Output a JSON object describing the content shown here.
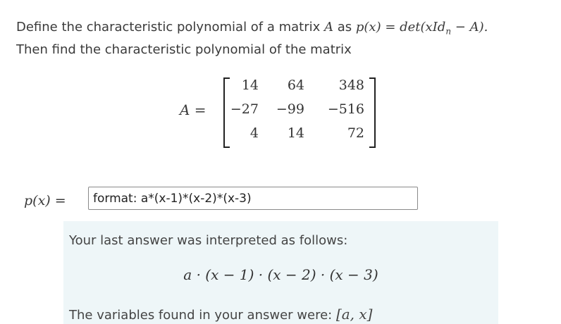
{
  "question": {
    "line1_text": "Define the characteristic polynomial of a matrix ",
    "line1_var": "A",
    "line1_as": " as ",
    "line1_formula": "p(x) = det(xId",
    "line1_sub": "n",
    "line1_formula_end": " − A).",
    "line2": "Then find the characteristic polynomial of the matrix"
  },
  "matrix": {
    "lhs": "A =",
    "rows": [
      [
        "14",
        "64",
        "348"
      ],
      [
        "−27",
        "−99",
        "−516"
      ],
      [
        "4",
        "14",
        "72"
      ]
    ]
  },
  "answer": {
    "label": "p(x) =",
    "value": "format: a*(x-1)*(x-2)*(x-3)"
  },
  "feedback": {
    "interpreted_text": "Your last answer was interpreted as follows:",
    "interpreted_expr": "a · (x − 1) · (x − 2) · (x − 3)",
    "variables_text": "The variables found in your answer were: ",
    "variables_value": "[a, x]"
  }
}
